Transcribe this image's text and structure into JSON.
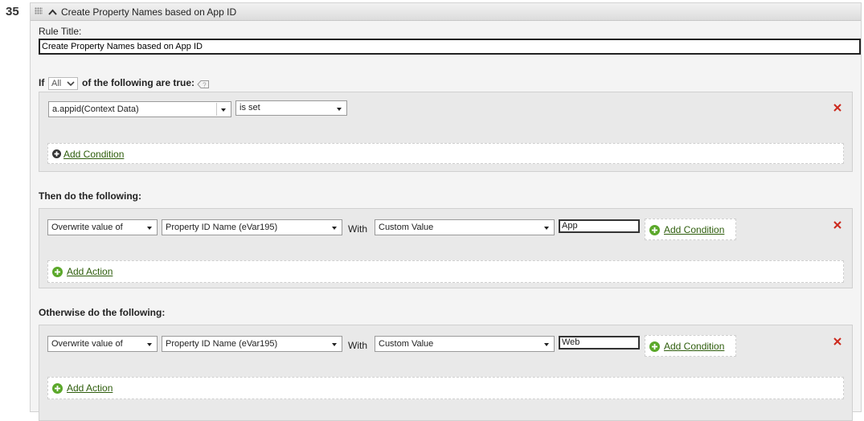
{
  "rule": {
    "number": "35",
    "header_title": "Create Property Names based on App ID",
    "title_label": "Rule Title:",
    "title_value": "Create Property Names based on App ID"
  },
  "conditions": {
    "if_label": "If",
    "match_value": "All",
    "following_label": "of the following are true:",
    "field_value": "a.appid(Context Data)",
    "operator_value": "is set",
    "add_condition_label": "Add Condition"
  },
  "then": {
    "heading": "Then do the following:",
    "action_value": "Overwrite value of",
    "variable_value": "Property ID Name (eVar195)",
    "with_label": "With",
    "value_type": "Custom Value",
    "custom_value": "App",
    "add_condition_label": "Add Condition",
    "add_action_label": "Add Action"
  },
  "otherwise": {
    "heading": "Otherwise do the following:",
    "action_value": "Overwrite value of",
    "variable_value": "Property ID Name (eVar195)",
    "with_label": "With",
    "value_type": "Custom Value",
    "custom_value": "Web",
    "add_condition_label": "Add Condition",
    "add_action_label": "Add Action"
  },
  "icons": {
    "drag": "drag-handle-icon",
    "collapse": "chevron-up-icon",
    "help": "help-icon",
    "remove": "close-icon",
    "add": "plus-circle-icon"
  },
  "colors": {
    "link": "#2e5d0c",
    "add_icon_green": "#5ba82a",
    "add_icon_dark": "#333333",
    "remove_red": "#cc2a1e",
    "panel_bg": "#f4f4f4",
    "section_bg": "#e9e9e9"
  }
}
